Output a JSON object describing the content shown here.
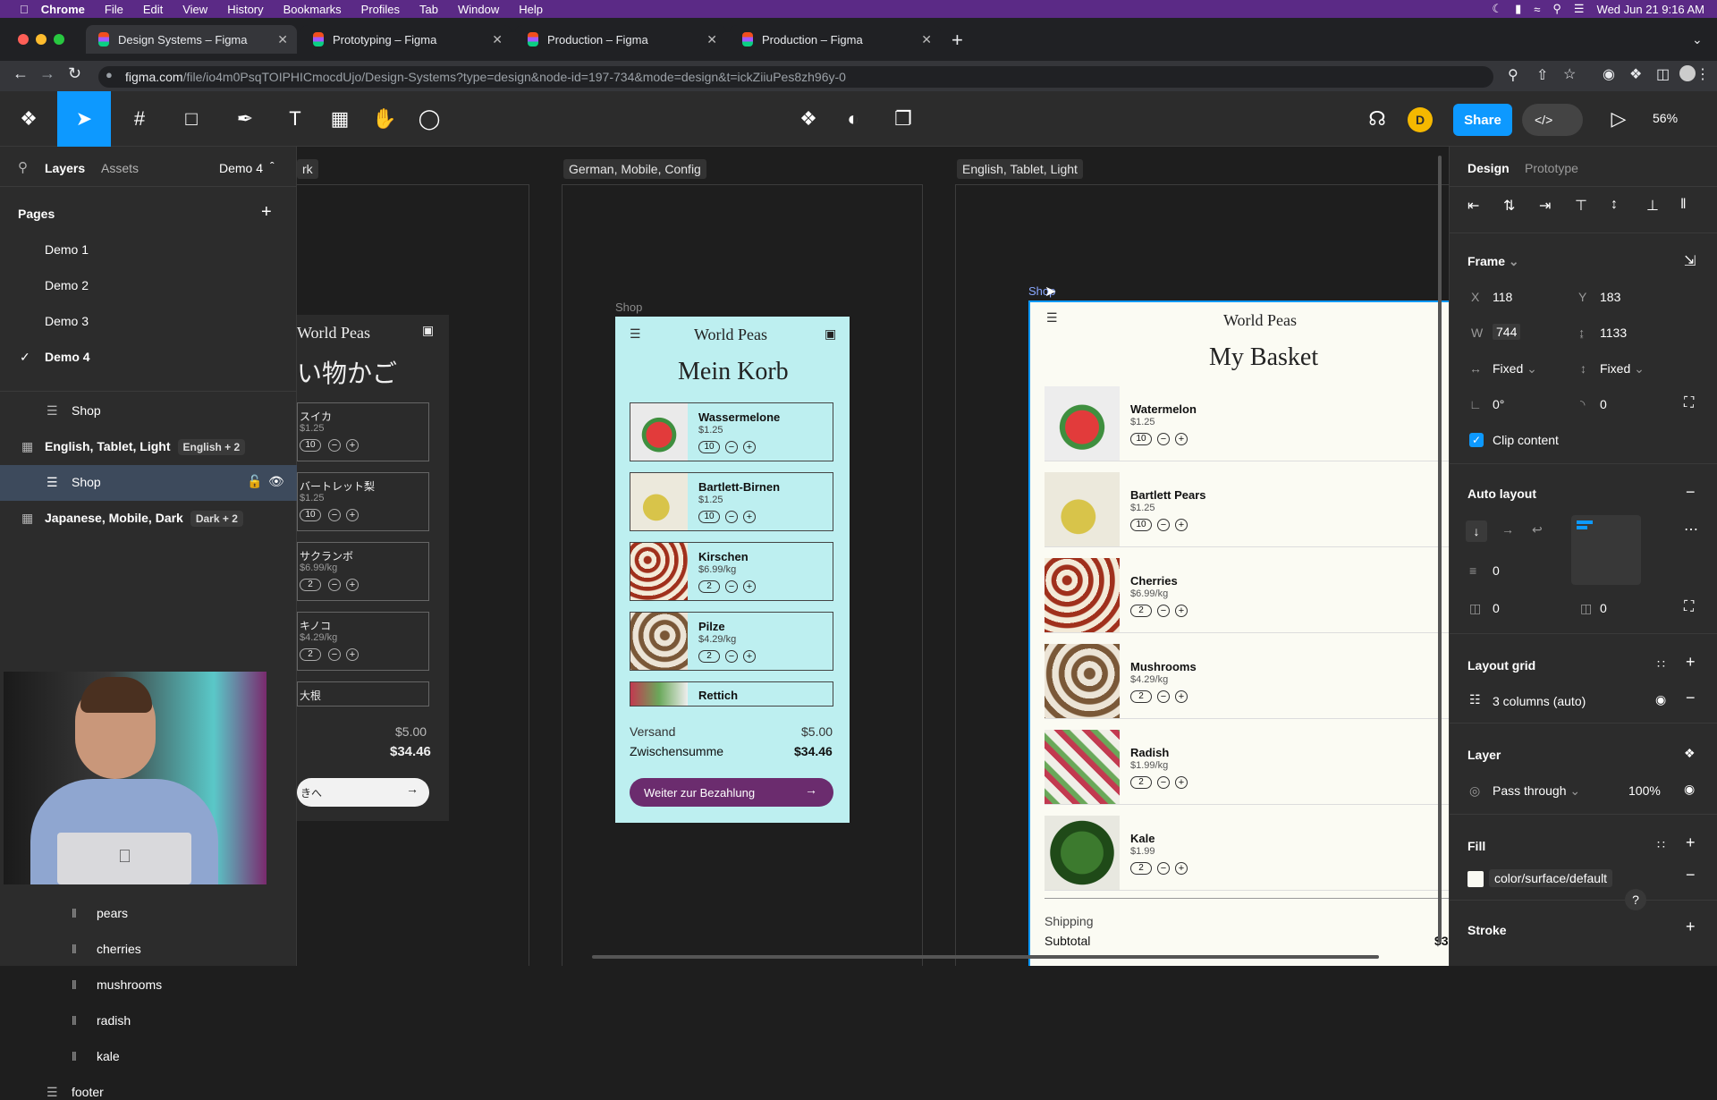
{
  "menubar": {
    "app": "Chrome",
    "items": [
      "File",
      "Edit",
      "View",
      "History",
      "Bookmarks",
      "Profiles",
      "Tab",
      "Window",
      "Help"
    ],
    "datetime": "Wed Jun 21  9:16 AM"
  },
  "tabs": [
    {
      "title": "Design Systems – Figma"
    },
    {
      "title": "Prototyping – Figma"
    },
    {
      "title": "Production – Figma"
    },
    {
      "title": "Production – Figma"
    }
  ],
  "address": {
    "domain": "figma.com",
    "path": "/file/io4m0PsqTOIPHICmocdUjo/Design-Systems?type=design&node-id=197-734&mode=design&t=ickZiiuPes8zh96y-0"
  },
  "toolbar": {
    "share_label": "Share",
    "avatar_initial": "D",
    "zoom": "56%"
  },
  "left_panel": {
    "tab_layers": "Layers",
    "tab_assets": "Assets",
    "page_selector": "Demo 4",
    "pages_heading": "Pages",
    "pages": [
      "Demo 1",
      "Demo 2",
      "Demo 3",
      "Demo 4"
    ],
    "layers": {
      "shop1": "Shop",
      "frame1": "English, Tablet, Light",
      "frame1_badge": "English + 2",
      "shop_selected": "Shop",
      "frame2": "Japanese, Mobile, Dark",
      "frame2_badge": "Dark + 2",
      "children": [
        "pears",
        "cherries",
        "mushrooms",
        "radish",
        "kale"
      ],
      "footer": "footer"
    }
  },
  "canvas": {
    "label_partial": "rk",
    "label_german": "German, Mobile, Config",
    "label_english": "English, Tablet, Light",
    "shop_label_small": "Shop",
    "shop_label_selected": "Shop",
    "japanese": {
      "brand": "World Peas",
      "title": "い物かご",
      "items": [
        {
          "name": "スイカ",
          "price": "$1.25",
          "qty": "10"
        },
        {
          "name": "バートレット梨",
          "price": "$1.25",
          "qty": "10"
        },
        {
          "name": "サクランボ",
          "price": "$6.99/kg",
          "qty": "2"
        },
        {
          "name": "キノコ",
          "price": "$4.29/kg",
          "qty": "2"
        },
        {
          "name": "大根",
          "price": "",
          "qty": ""
        }
      ],
      "shipping": "$5.00",
      "subtotal": "$34.46",
      "cta": "きへ"
    },
    "german": {
      "brand": "World Peas",
      "title": "Mein Korb",
      "items": [
        {
          "name": "Wassermelone",
          "price": "$1.25",
          "qty": "10"
        },
        {
          "name": "Bartlett-Birnen",
          "price": "$1.25",
          "qty": "10"
        },
        {
          "name": "Kirschen",
          "price": "$6.99/kg",
          "qty": "2"
        },
        {
          "name": "Pilze",
          "price": "$4.29/kg",
          "qty": "2"
        },
        {
          "name": "Rettich",
          "price": "",
          "qty": ""
        }
      ],
      "shipping_label": "Versand",
      "shipping": "$5.00",
      "subtotal_label": "Zwischensumme",
      "subtotal": "$34.46",
      "cta": "Weiter zur Bezahlung"
    },
    "english": {
      "brand": "World Peas",
      "title": "My Basket",
      "items": [
        {
          "name": "Watermelon",
          "price": "$1.25",
          "qty": "10"
        },
        {
          "name": "Bartlett Pears",
          "price": "$1.25",
          "qty": "10"
        },
        {
          "name": "Cherries",
          "price": "$6.99/kg",
          "qty": "2"
        },
        {
          "name": "Mushrooms",
          "price": "$4.29/kg",
          "qty": "2"
        },
        {
          "name": "Radish",
          "price": "$1.99/kg",
          "qty": "2"
        },
        {
          "name": "Kale",
          "price": "$1.99",
          "qty": "2"
        }
      ],
      "shipping_label": "Shipping",
      "subtotal_label": "Subtotal",
      "subtotal_partial": "$3"
    }
  },
  "right_panel": {
    "tab_design": "Design",
    "tab_prototype": "Prototype",
    "frame_heading": "Frame",
    "x_label": "X",
    "x": "118",
    "y_label": "Y",
    "y": "183",
    "w_label": "W",
    "w": "744",
    "h": "1133",
    "width_mode": "Fixed",
    "height_mode": "Fixed",
    "rotation": "0°",
    "radius": "0",
    "clip_content": "Clip content",
    "autolayout_heading": "Auto layout",
    "gap": "0",
    "pad_h": "0",
    "pad_v": "0",
    "layout_grid_heading": "Layout grid",
    "layout_grid_value": "3 columns (auto)",
    "layer_heading": "Layer",
    "blend": "Pass through",
    "opacity": "100%",
    "fill_heading": "Fill",
    "fill_value": "color/surface/default",
    "stroke_heading": "Stroke",
    "help": "?"
  },
  "colors": {
    "accent": "#0d99ff",
    "menubar": "#5b2a86",
    "german_bg": "#bdeff0",
    "german_cta": "#6b2c6e",
    "english_bg": "#fbfbf3",
    "japanese_bg": "#2b2b2b"
  }
}
